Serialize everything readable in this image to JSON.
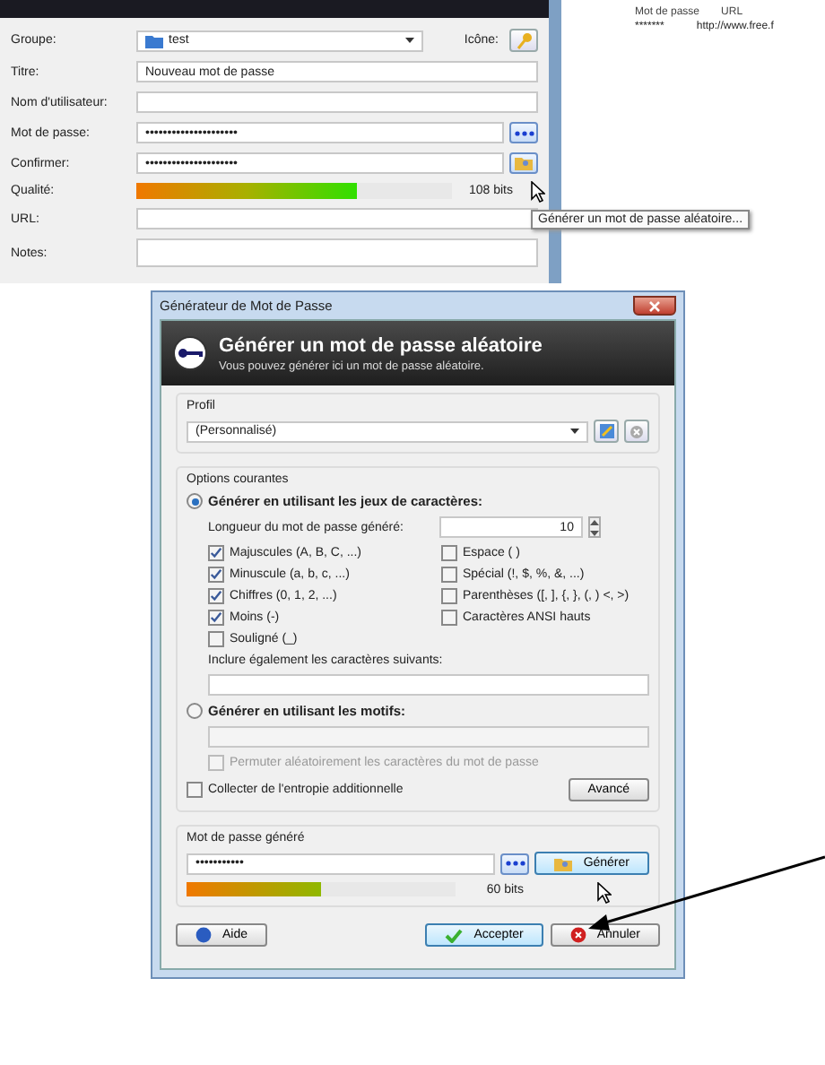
{
  "entry_dialog": {
    "group": {
      "label": "Groupe:",
      "value": "test"
    },
    "icon_label": "Icône:",
    "fields": [
      {
        "label": "Titre:",
        "value": "Nouveau mot de passe"
      },
      {
        "label": "Nom d'utilisateur:"
      }
    ],
    "password": {
      "label": "Mot de passe:",
      "value": "•••••••••••••••••••••"
    },
    "confirm": {
      "label": "Confirmer:",
      "value": "•••••••••••••••••••••"
    },
    "quality": {
      "label": "Qualité:",
      "level": 0.7,
      "reading": "108 bits"
    },
    "url": {
      "label": "URL:"
    },
    "notes": {
      "label": "Notes:"
    },
    "tooltip": "Générer un mot de passe aléatoire..."
  },
  "entry_list": {
    "columns": [
      "Mot de passe",
      "URL"
    ],
    "rows": [
      [
        "*******",
        "http://www.free.f"
      ]
    ]
  },
  "generator": {
    "title": "Générateur de Mot de Passe",
    "heading": "Générer un mot de passe aléatoire",
    "subtitle": "Vous pouvez générer ici un mot de passe aléatoire.",
    "profile": {
      "legend": "Profil",
      "value": "(Personnalisé)"
    },
    "options": {
      "legend": "Options courantes",
      "charset_mode": {
        "label": "Générer en utilisant les jeux de caractères:",
        "selected": true
      },
      "length": {
        "label": "Longueur du mot de passe généré:",
        "value": "10"
      },
      "left": [
        {
          "label": "Majuscules (A, B, C, ...)",
          "checked": true
        },
        {
          "label": "Minuscule (a, b, c, ...)",
          "checked": true
        },
        {
          "label": "Chiffres (0, 1, 2, ...)",
          "checked": true
        },
        {
          "label": "Moins (-)",
          "checked": true
        },
        {
          "label": "Souligné (_)",
          "checked": false
        }
      ],
      "right": [
        {
          "label": "Espace ( )",
          "checked": false
        },
        {
          "label": "Spécial (!, $, %, &, ...)",
          "checked": false
        },
        {
          "label": "Parenthèses ([, ], {, }, (, ) <, >)",
          "checked": false
        },
        {
          "label": "Caractères ANSI hauts",
          "checked": false
        }
      ],
      "include_label": "Inclure également les caractères suivants:",
      "pattern_mode": {
        "label": "Générer  en utilisant les motifs:",
        "selected": false
      },
      "permute": {
        "label": "Permuter aléatoirement les caractères du mot de passe",
        "checked": false,
        "disabled": true
      },
      "entropy": {
        "label": "Collecter de l'entropie additionnelle",
        "checked": false
      },
      "advanced": "Avancé"
    },
    "generated": {
      "legend": "Mot de passe généré",
      "value": "•••••••••••",
      "generate": "Générer",
      "level": 0.5,
      "reading": "60 bits"
    },
    "buttons": {
      "help": "Aide",
      "accept": "Accepter",
      "cancel": "Annuler"
    }
  }
}
